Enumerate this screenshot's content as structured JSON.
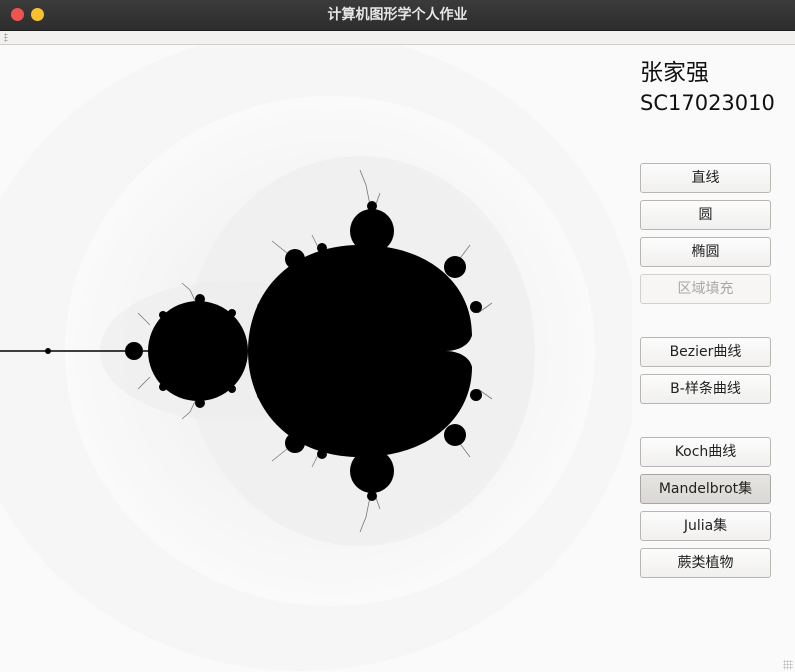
{
  "window": {
    "title": "计算机图形学个人作业"
  },
  "info": {
    "name": "张家强",
    "student_id": "SC17023010"
  },
  "buttons": [
    {
      "label": "直线",
      "state": "normal",
      "name": "line-button"
    },
    {
      "label": "圆",
      "state": "normal",
      "name": "circle-button"
    },
    {
      "label": "椭圆",
      "state": "normal",
      "name": "ellipse-button"
    },
    {
      "label": "区域填充",
      "state": "disabled",
      "name": "region-fill-button"
    },
    {
      "label": "Bezier曲线",
      "state": "normal",
      "name": "bezier-curve-button"
    },
    {
      "label": "B-样条曲线",
      "state": "normal",
      "name": "b-spline-curve-button"
    },
    {
      "label": "Koch曲线",
      "state": "normal",
      "name": "koch-curve-button"
    },
    {
      "label": "Mandelbrot集",
      "state": "active",
      "name": "mandelbrot-set-button"
    },
    {
      "label": "Julia集",
      "state": "normal",
      "name": "julia-set-button"
    },
    {
      "label": "蕨类植物",
      "state": "normal",
      "name": "fern-button"
    }
  ],
  "colors": {
    "titlebar": "#2d2d2d",
    "close": "#ef5350",
    "minimize": "#fbc02d",
    "fractal": "#000000",
    "canvas_bg": "#fafafa"
  },
  "canvas": {
    "fractal": "Mandelbrot"
  }
}
